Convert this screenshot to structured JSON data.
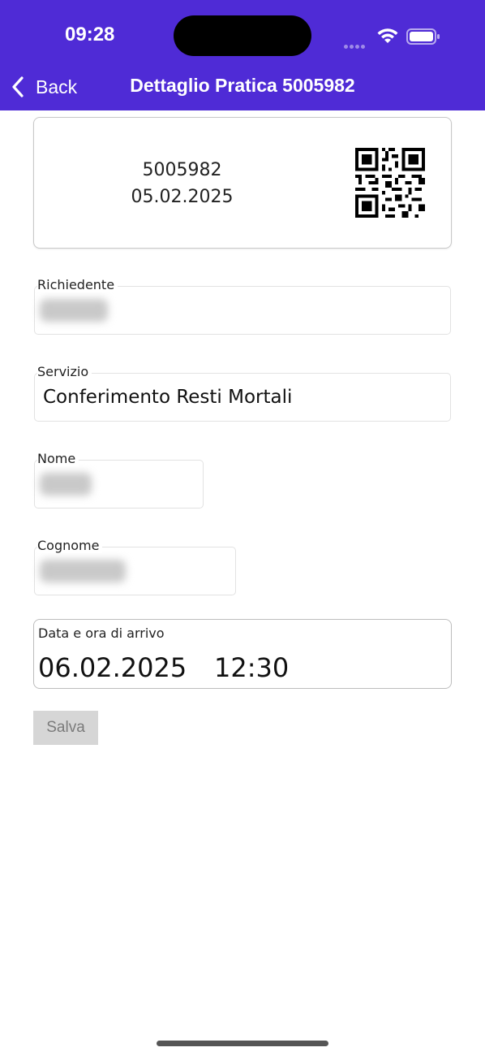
{
  "status_bar": {
    "time": "09:28"
  },
  "nav": {
    "back_label": "Back",
    "title": "Dettaglio Pratica 5005982"
  },
  "summary_card": {
    "number": "5005982",
    "date": "05.02.2025"
  },
  "fields": {
    "richiedente": {
      "label": "Richiedente",
      "value": ""
    },
    "servizio": {
      "label": "Servizio",
      "value": "Conferimento Resti Mortali"
    },
    "nome": {
      "label": "Nome",
      "value": ""
    },
    "cognome": {
      "label": "Cognome",
      "value": ""
    }
  },
  "arrival": {
    "label": "Data e ora di arrivo",
    "date": "06.02.2025",
    "time": "12:30"
  },
  "actions": {
    "save_label": "Salva"
  },
  "colors": {
    "header_bg": "#4f2bd6",
    "button_disabled_bg": "#d6d6d6"
  },
  "icons": [
    "back-chevron-icon",
    "wifi-icon",
    "battery-icon",
    "signal-icon",
    "qr-code-icon"
  ]
}
